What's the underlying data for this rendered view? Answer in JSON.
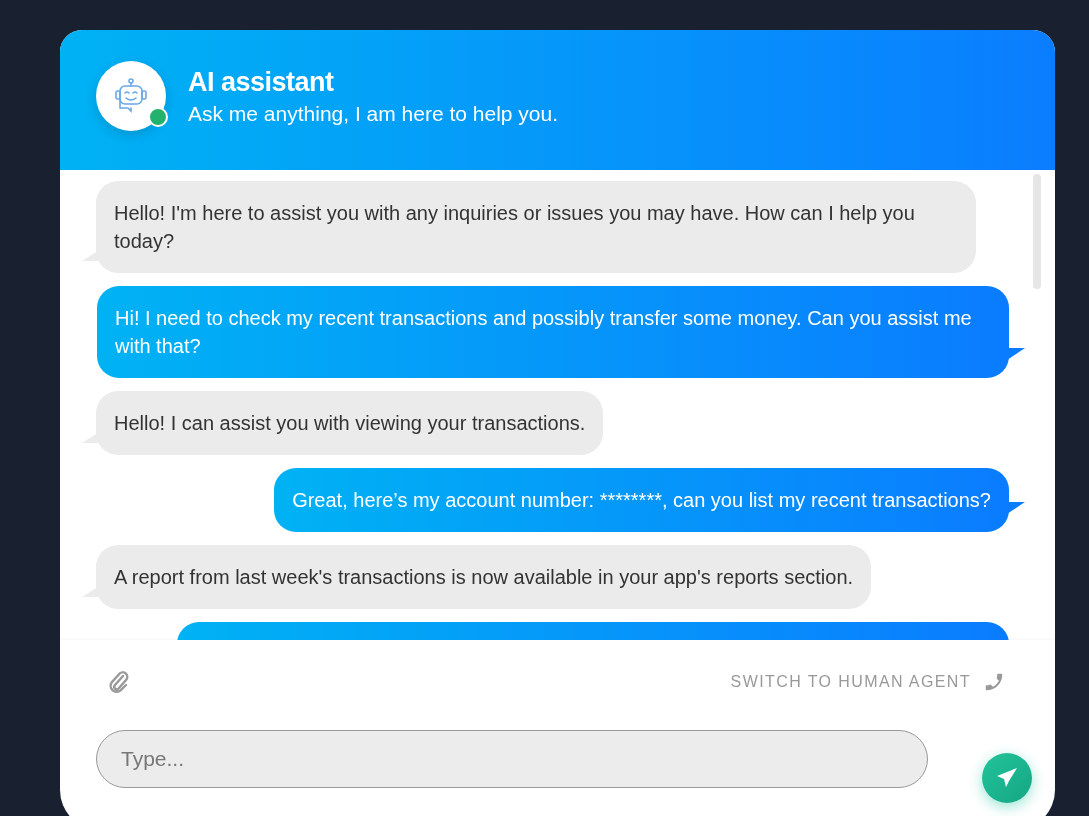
{
  "header": {
    "title": "AI assistant",
    "subtitle": "Ask me anything, I am here to help you.",
    "online": true
  },
  "messages": [
    {
      "kind": "bot",
      "text": "Hello! I'm here to assist you with any inquiries or issues you may have. How can I help you today?"
    },
    {
      "kind": "user",
      "text": "Hi! I need to check my recent transactions and possibly transfer some money. Can you assist me with that?"
    },
    {
      "kind": "bot",
      "text": "Hello! I can assist you with viewing your transactions."
    },
    {
      "kind": "user",
      "text": "Great, here’s my account number: ********, can you list my recent transactions?"
    },
    {
      "kind": "bot",
      "text": "A report from last week's transactions is now available in your app's reports section."
    },
    {
      "kind": "user_partial"
    }
  ],
  "footer": {
    "switch_label": "SWITCH TO HUMAN AGENT",
    "input": {
      "placeholder": "Type..."
    }
  }
}
